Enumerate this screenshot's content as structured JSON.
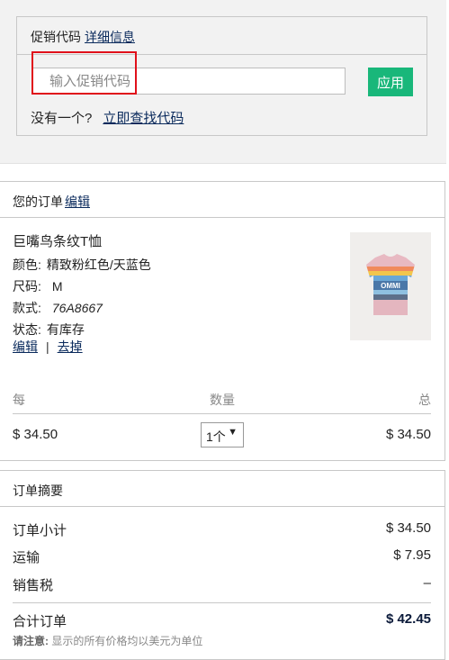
{
  "promo": {
    "title": "促销代码",
    "details_link": "详细信息",
    "input_placeholder": "输入促销代码",
    "apply_label": "应用",
    "no_code_text": "没有一个?",
    "find_code_link": "立即查找代码"
  },
  "order": {
    "header_title": "您的订单",
    "edit_link": "编辑",
    "product_name": "巨嘴鸟条纹T恤",
    "color_label": "颜色:",
    "color_value": "精致粉红色/天蓝色",
    "size_label": "尺码:",
    "size_value": "M",
    "style_label": "款式:",
    "style_value": "76A8667",
    "status_label": "状态:",
    "status_value": "有库存",
    "item_edit_link": "编辑",
    "separator": "|",
    "remove_link": "去掉",
    "col_each": "每",
    "col_qty": "数量",
    "col_total": "总",
    "price_each": "$ 34.50",
    "qty_value": "1个",
    "price_total": "$ 34.50"
  },
  "summary": {
    "header_title": "订单摘要",
    "subtotal_label": "订单小计",
    "subtotal_value": "$ 34.50",
    "shipping_label": "运输",
    "shipping_value": "$ 7.95",
    "tax_label": "销售税",
    "tax_value": "–",
    "total_label": "合计订单",
    "total_value": "$ 42.45",
    "note_label": "请注意:",
    "note_text": "显示的所有价格均以美元为单位"
  },
  "colors": {
    "apply_button": "#19b77a",
    "link": "#0a2a5c",
    "highlight": "#e0101b"
  }
}
